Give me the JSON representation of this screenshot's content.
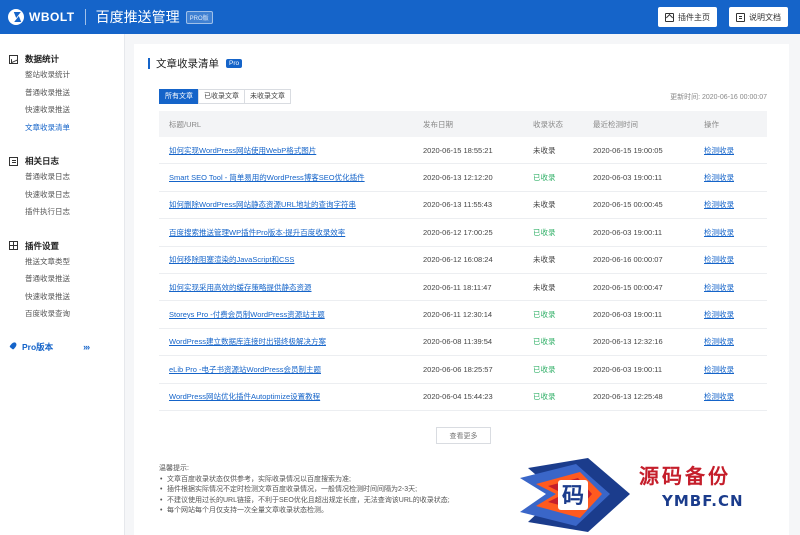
{
  "header": {
    "brand": "WBOLT",
    "app_title": "百度推送管理",
    "pro_tag": "PRO版",
    "btn_plugin_home": "插件主页",
    "btn_docs": "说明文档"
  },
  "sidebar": {
    "groups": [
      {
        "title": "数据统计",
        "icon": "chart-icon",
        "items": [
          "整站收录统计",
          "普通收录推送",
          "快速收录推送",
          "文章收录清单"
        ]
      },
      {
        "title": "相关日志",
        "icon": "log-icon",
        "items": [
          "普通收录日志",
          "快速收录日志",
          "插件执行日志"
        ]
      },
      {
        "title": "插件设置",
        "icon": "settings-icon",
        "items": [
          "推送文章类型",
          "普通收录推送",
          "快速收录推送",
          "百度收录查询"
        ]
      }
    ],
    "active_item": "文章收录清单",
    "pro_link": "Pro版本",
    "pro_arrows": "›››"
  },
  "main": {
    "title": "文章收录清单",
    "pro_badge": "Pro",
    "tabs": [
      "所有文章",
      "已收录文章",
      "未收录文章"
    ],
    "active_tab": "所有文章",
    "update_time": "更新时间: 2020-06-16 00:00:07",
    "table": {
      "headers": [
        "标题/URL",
        "发布日期",
        "收录状态",
        "最近检测时间",
        "操作"
      ],
      "rows": [
        {
          "title": "如何实现WordPress网站使用WebP格式图片",
          "date": "2020-06-15 18:55:21",
          "status": "未收录",
          "indexed": false,
          "checked": "2020-06-15 19:00:05",
          "action": "检测收录"
        },
        {
          "title": "Smart SEO Tool - 简单易用的WordPress博客SEO优化插件",
          "date": "2020-06-13 12:12:20",
          "status": "已收录",
          "indexed": true,
          "checked": "2020-06-03 19:00:11",
          "action": "检测收录"
        },
        {
          "title": "如何删除WordPress网站静态资源URL地址的查询字符串",
          "date": "2020-06-13 11:55:43",
          "status": "未收录",
          "indexed": false,
          "checked": "2020-06-15 00:00:45",
          "action": "检测收录"
        },
        {
          "title": "百度搜索推送管理WP插件Pro版本-提升百度收录效率",
          "date": "2020-06-12 17:00:25",
          "status": "已收录",
          "indexed": true,
          "checked": "2020-06-03 19:00:11",
          "action": "检测收录"
        },
        {
          "title": "如何移除阻塞渲染的JavaScript和CSS",
          "date": "2020-06-12 16:08:24",
          "status": "未收录",
          "indexed": false,
          "checked": "2020-06-16 00:00:07",
          "action": "检测收录"
        },
        {
          "title": "如何实现采用高效的缓存策略提供静态资源",
          "date": "2020-06-11 18:11:47",
          "status": "未收录",
          "indexed": false,
          "checked": "2020-06-15 00:00:47",
          "action": "检测收录"
        },
        {
          "title": "Storeys Pro -付费会员制WordPress资源站主题",
          "date": "2020-06-11 12:30:14",
          "status": "已收录",
          "indexed": true,
          "checked": "2020-06-03 19:00:11",
          "action": "检测收录"
        },
        {
          "title": "WordPress建立数据库连接时出错终极解决方案",
          "date": "2020-06-08 11:39:54",
          "status": "已收录",
          "indexed": true,
          "checked": "2020-06-13 12:32:16",
          "action": "检测收录"
        },
        {
          "title": "eLib Pro -电子书资源站WordPress会员制主题",
          "date": "2020-06-06 18:25:57",
          "status": "已收录",
          "indexed": true,
          "checked": "2020-06-03 19:00:11",
          "action": "检测收录"
        },
        {
          "title": "WordPress网站优化插件Autoptimize设置教程",
          "date": "2020-06-04 15:44:23",
          "status": "已收录",
          "indexed": true,
          "checked": "2020-06-13 12:25:48",
          "action": "检测收录"
        }
      ]
    },
    "more_button": "查看更多",
    "notes_title": "温馨提示:",
    "notes": [
      "文章百度收录状态仅供参考，实际收录情况以百度搜索为准;",
      "插件根据实际情况不定时检测文章百度收录情况，一般情况检测时间间隔为2-3天;",
      "不建议使用过长的URL链接，不利于SEO优化且超出规定长度，无法查询该URL的收录状态;",
      "每个网站每个月仅支持一次全量文章收录状态检测。"
    ]
  },
  "watermark": {
    "cn": "源码备份",
    "en": "YMBF.CN",
    "glyph": "码"
  },
  "colors": {
    "primary": "#1564c9",
    "indexed": "#34b16a",
    "watermark_red": "#c51e2b",
    "watermark_blue": "#1b3c8c"
  }
}
